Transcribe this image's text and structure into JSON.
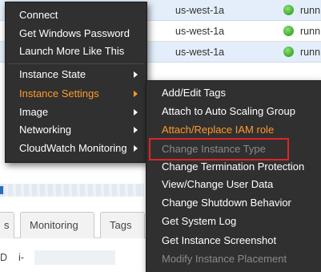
{
  "table": {
    "rows": [
      {
        "az": "us-west-1a",
        "state": "runn"
      },
      {
        "az": "us-west-1a",
        "state": "runn"
      },
      {
        "az": "us-west-1a",
        "state": "runn"
      }
    ]
  },
  "tabs": [
    {
      "label": "s"
    },
    {
      "label": "Monitoring"
    },
    {
      "label": "Tags"
    }
  ],
  "detail": {
    "label": "D",
    "value": "i-"
  },
  "context_menu": {
    "items": [
      {
        "label": "Connect"
      },
      {
        "label": "Get Windows Password"
      },
      {
        "label": "Launch More Like This"
      },
      {
        "label": "Instance State"
      },
      {
        "label": "Instance Settings"
      },
      {
        "label": "Image"
      },
      {
        "label": "Networking"
      },
      {
        "label": "CloudWatch Monitoring"
      }
    ]
  },
  "submenu": {
    "items": [
      {
        "label": "Add/Edit Tags"
      },
      {
        "label": "Attach to Auto Scaling Group"
      },
      {
        "label": "Attach/Replace IAM role"
      },
      {
        "label": "Change Instance Type"
      },
      {
        "label": "Change Termination Protection"
      },
      {
        "label": "View/Change User Data"
      },
      {
        "label": "Change Shutdown Behavior"
      },
      {
        "label": "Get System Log"
      },
      {
        "label": "Get Instance Screenshot"
      },
      {
        "label": "Modify Instance Placement"
      }
    ]
  },
  "colors": {
    "menu_bg": "#303030",
    "active_text": "#ff9a2a",
    "disabled_text": "#8a8a8a",
    "highlight_border": "#e0232a",
    "selected_row": "#e4eefa",
    "running_green": "#3daa2b"
  },
  "icons": {
    "submenu_arrow": "chevron-right-icon",
    "running_state": "green-dot-icon"
  }
}
